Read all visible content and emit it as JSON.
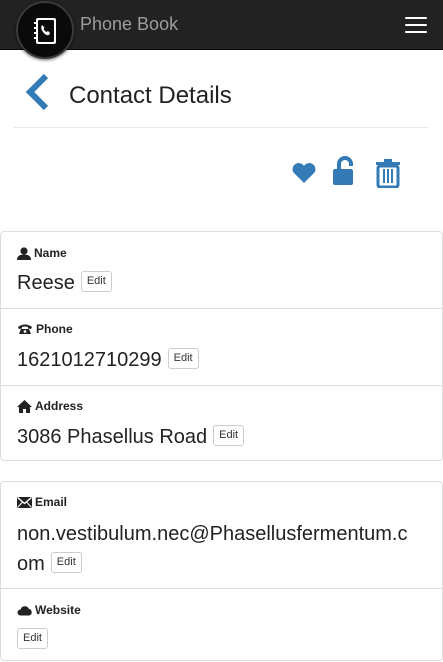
{
  "app": {
    "brand": "Phone Book"
  },
  "page": {
    "title": "Contact Details"
  },
  "icons": {
    "logo": "address-book-icon",
    "menu": "hamburger-icon",
    "back": "chevron-left-icon",
    "favorite": "heart-icon",
    "lock": "unlock-icon",
    "delete": "trash-icon"
  },
  "colors": {
    "accent": "#337ab7",
    "navbar": "#222222"
  },
  "contact": {
    "name": {
      "label": "Name",
      "value": "Reese",
      "edit": "Edit",
      "icon": "user-icon"
    },
    "phone": {
      "label": "Phone",
      "value": "1621012710299",
      "edit": "Edit",
      "icon": "phone-icon"
    },
    "address": {
      "label": "Address",
      "value": "3086 Phasellus Road",
      "edit": "Edit",
      "icon": "home-icon"
    },
    "email": {
      "label": "Email",
      "value": "non.vestibulum.nec@Phasellusfermentum.com",
      "edit": "Edit",
      "icon": "envelope-icon"
    },
    "website": {
      "label": "Website",
      "value": "",
      "edit": "Edit",
      "icon": "cloud-icon"
    }
  }
}
